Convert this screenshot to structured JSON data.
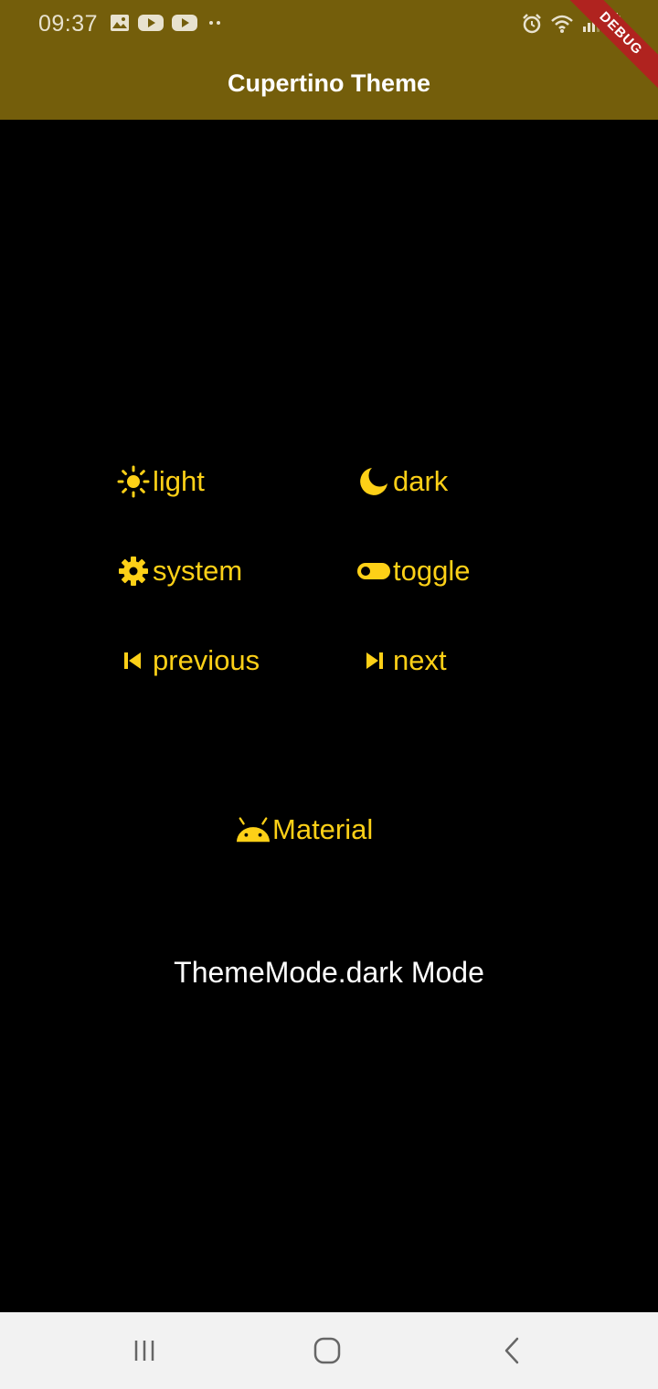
{
  "status_bar": {
    "time": "09:37",
    "left_icons": [
      "image-icon",
      "youtube-icon",
      "youtube-icon",
      "more-dots-icon"
    ],
    "right_icons": [
      "alarm-icon",
      "wifi-icon",
      "signal-icon",
      "battery-icon"
    ]
  },
  "app_bar": {
    "title": "Cupertino Theme",
    "background": "#745e0b"
  },
  "debug_banner": "DEBUG",
  "buttons": {
    "light": {
      "label": "light",
      "icon": "sun-icon"
    },
    "dark": {
      "label": "dark",
      "icon": "moon-icon"
    },
    "system": {
      "label": "system",
      "icon": "gear-icon"
    },
    "toggle": {
      "label": "toggle",
      "icon": "toggle-icon"
    },
    "previous": {
      "label": "previous",
      "icon": "skip-previous-icon"
    },
    "next": {
      "label": "next",
      "icon": "skip-next-icon"
    },
    "material": {
      "label": "Material",
      "icon": "android-icon"
    }
  },
  "mode_text": "ThemeMode.dark Mode",
  "colors": {
    "accent": "#fdd017",
    "background": "#000000",
    "text": "#ffffff",
    "nav_bar": "#f2f2f2"
  },
  "nav_bar": {
    "buttons": [
      "recents-icon",
      "home-icon",
      "back-icon"
    ]
  }
}
